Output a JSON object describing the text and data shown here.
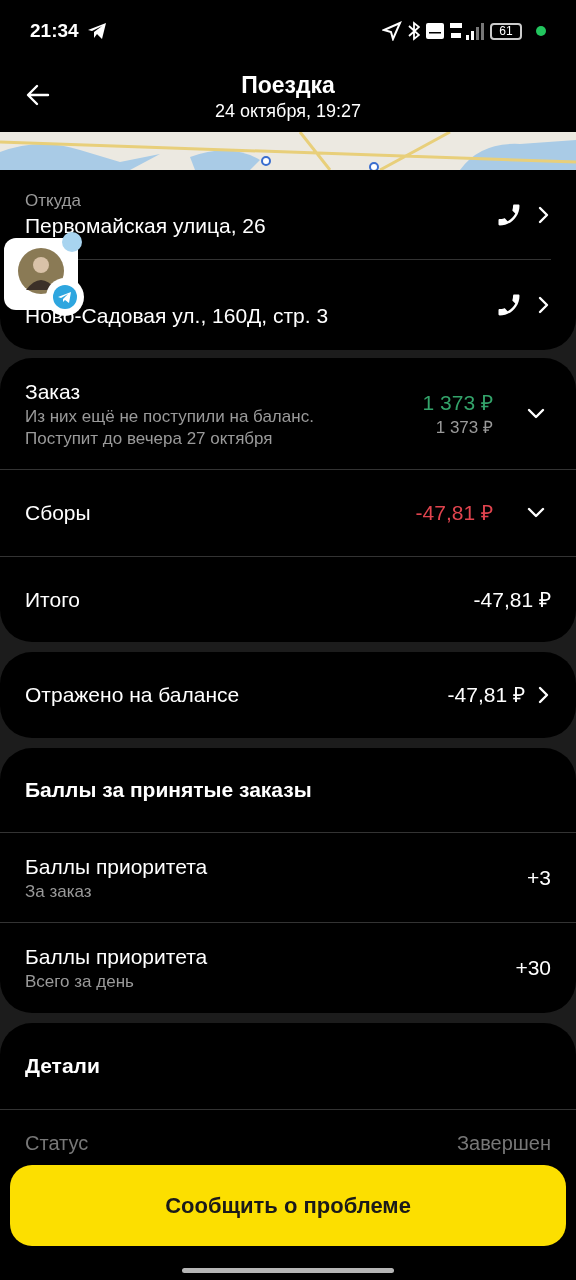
{
  "status_bar": {
    "time": "21:34",
    "battery": "61"
  },
  "header": {
    "title": "Поездка",
    "subtitle": "24 октября, 19:27"
  },
  "route": [
    {
      "label": "Откуда",
      "address": "Первомайская улица, 26"
    },
    {
      "address": "Ново-Садовая ул., 160Д, стр. 3"
    }
  ],
  "summary_rows": [
    {
      "kind": "income",
      "label": "Заказ",
      "note": "Из них ещё не поступили на баланс.\nПоступит до вечера 27 октября",
      "amount": "1 373 ₽",
      "amount_secondary": "1 373 ₽"
    },
    {
      "kind": "fee",
      "label": "Сборы",
      "amount": "-47,81 ₽"
    },
    {
      "kind": "total",
      "label": "Итого",
      "amount": "-47,81 ₽"
    }
  ],
  "balance": {
    "label": "Отражено на балансе",
    "amount": "-47,81 ₽"
  },
  "points": {
    "title": "Баллы за принятые заказы",
    "rows": [
      {
        "title": "Баллы приоритета",
        "subtitle": "За заказ",
        "value": "+3"
      },
      {
        "title": "Баллы приоритета",
        "subtitle": "Всего за день",
        "value": "+30"
      }
    ]
  },
  "details": {
    "title": "Детали",
    "rows": [
      {
        "label": "Статус",
        "value": "Завершен"
      }
    ]
  },
  "report_button": "Сообщить о проблеме"
}
